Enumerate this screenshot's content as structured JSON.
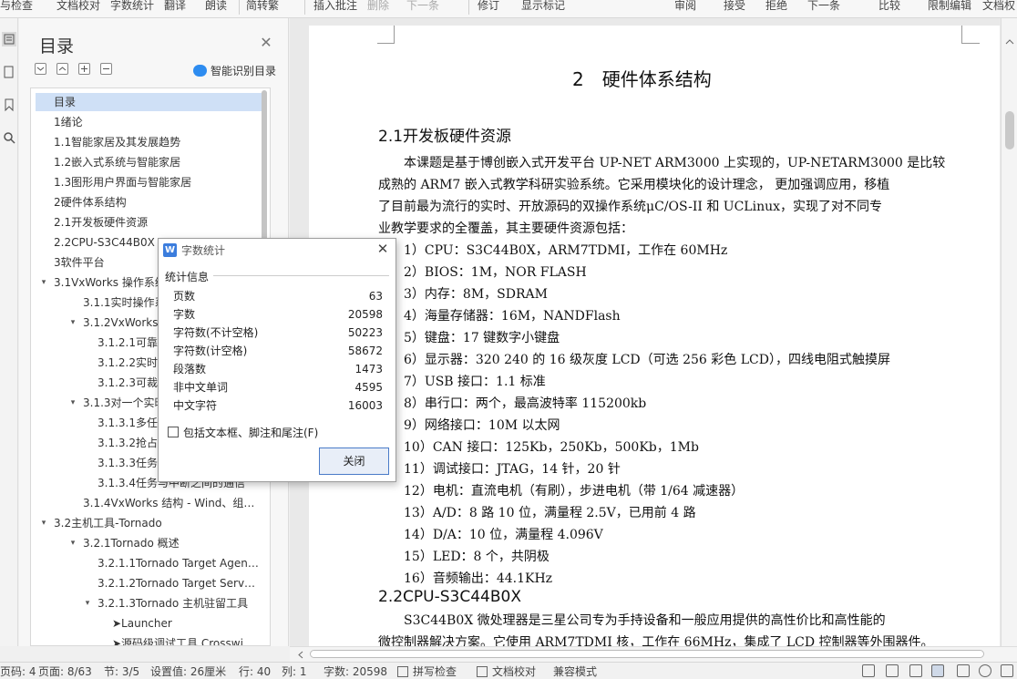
{
  "ribbon": {
    "items": [
      {
        "label": "与检查",
        "disabled": false
      },
      {
        "label": "文档校对",
        "disabled": false
      },
      {
        "label": "字数统计",
        "disabled": false
      },
      {
        "label": "翻译",
        "disabled": false
      },
      {
        "label": "朗读",
        "disabled": false
      },
      {
        "label": "简转繁",
        "disabled": false
      },
      {
        "label": "插入批注",
        "disabled": false
      },
      {
        "label": "删除",
        "disabled": true
      },
      {
        "label": "下一条",
        "disabled": true
      },
      {
        "label": "修订",
        "disabled": false
      },
      {
        "label": "显示标记",
        "disabled": false
      },
      {
        "label": "审阅",
        "disabled": false
      },
      {
        "label": "接受",
        "disabled": false
      },
      {
        "label": "拒绝",
        "disabled": false
      },
      {
        "label": "下一条",
        "disabled": false
      },
      {
        "label": "比较",
        "disabled": false
      },
      {
        "label": "限制编辑",
        "disabled": false
      },
      {
        "label": "文档权",
        "disabled": false
      }
    ]
  },
  "toc": {
    "title": "目录",
    "smart_label": "智能识别目录",
    "items": [
      {
        "label": "目录",
        "selected": true
      },
      {
        "label": "1绪论"
      },
      {
        "label": "1.1智能家居及其发展趋势"
      },
      {
        "label": "1.2嵌入式系统与智能家居"
      },
      {
        "label": "1.3图形用户界面与智能家居"
      },
      {
        "label": "2硬件体系结构"
      },
      {
        "label": "2.1开发板硬件资源"
      },
      {
        "label": "2.2CPU-S3C44B0X"
      },
      {
        "label": "3软件平台"
      },
      {
        "label": "3.1VxWorks 操作系统",
        "toggle": "▾"
      },
      {
        "label": "3.1.1实时操作系统"
      },
      {
        "label": "3.1.2VxWorks",
        "toggle": "▾"
      },
      {
        "label": "3.1.2.1可靠性"
      },
      {
        "label": "3.1.2.2实时性"
      },
      {
        "label": "3.1.2.3可裁减"
      },
      {
        "label": "3.1.3对一个实时",
        "toggle": "▾"
      },
      {
        "label": "3.1.3.1多任务"
      },
      {
        "label": "3.1.3.2抢占调度"
      },
      {
        "label": "3.1.3.3任务间"
      },
      {
        "label": "3.1.3.4任务与中断之间的通信"
      },
      {
        "label": "3.1.4VxWorks 结构 - Wind、组…"
      },
      {
        "label": "3.2主机工具-Tornado",
        "toggle": "▾"
      },
      {
        "label": "3.2.1Tornado 概述",
        "toggle": "▾"
      },
      {
        "label": "3.2.1.1Tornado Target Agen…"
      },
      {
        "label": "3.2.1.2Tornado Target Serve…"
      },
      {
        "label": "3.2.1.3Tornado 主机驻留工具",
        "toggle": "▾"
      },
      {
        "label": "➤Launcher"
      },
      {
        "label": "➤源码级调试工具 Crosswi…"
      }
    ]
  },
  "document": {
    "chapter_title": "2　硬件体系结构",
    "sec1_title": "2.1开发板硬件资源",
    "para1": [
      "本课题是基于博创嵌入式开发平台 UP-NET ARM3000 上实现的，UP-NETARM3000 是比较",
      "成熟的 ARM7 嵌入式教学科研实验系统。它采用模块化的设计理念，  更加强调应用，移植",
      "了目前最为流行的实时、开放源码的双操作系统μC/OS-II 和 UCLinux，实现了对不同专",
      "业教学要求的全覆盖，其主要硬件资源包括："
    ],
    "list": [
      "1）CPU：S3C44B0X，ARM7TDMI，工作在 60MHz",
      "2）BIOS：1M，NOR FLASH",
      "3）内存：8M，SDRAM",
      "4）海量存储器：16M，NANDFlash",
      "5）键盘：17 键数字小键盘",
      "6）显示器：320 240 的 16 级灰度 LCD（可选 256 彩色 LCD），四线电阻式触摸屏",
      "7）USB 接口：1.1 标准",
      "8）串行口：两个，最高波特率 115200kb",
      "9）网络接口：10M 以太网",
      "10）CAN 接口：125Kb，250Kb，500Kb，1Mb",
      "11）调试接口：JTAG，14 针，20 针",
      "12）电机：直流电机（有刷），步进电机（带 1/64 减速器）",
      "13）A/D：8 路 10 位，满量程 2.5V，已用前 4 路",
      "14）D/A：10 位，满量程 4.096V",
      "15）LED：8 个，共阴极",
      "16）音频输出：44.1KHz"
    ],
    "sec2_title": "2.2CPU-S3C44B0X",
    "para2": [
      "S3C44B0X 微处理器是三星公司专为手持设备和一般应用提供的高性价比和高性能的",
      "微控制器解决方案。它使用 ARM7TDMI 核，工作在 66MHz，集成了 LCD 控制器等外围器件。"
    ]
  },
  "dialog": {
    "title": "字数统计",
    "section": "统计信息",
    "rows": [
      {
        "label": "页数",
        "value": "63"
      },
      {
        "label": "字数",
        "value": "20598"
      },
      {
        "label": "字符数(不计空格)",
        "value": "50223"
      },
      {
        "label": "字符数(计空格)",
        "value": "58672"
      },
      {
        "label": "段落数",
        "value": "1473"
      },
      {
        "label": "非中文单词",
        "value": "4595"
      },
      {
        "label": "中文字符",
        "value": "16003"
      }
    ],
    "checkbox_label": "包括文本框、脚注和尾注(F)",
    "close_label": "关闭"
  },
  "status": {
    "page_num": "页码: 4",
    "page": "页面: 8/63",
    "section": "节: 3/5",
    "position": "设置值: 26厘米",
    "row": "行: 40",
    "col": "列: 1",
    "words": "字数: 20598",
    "spell": "拼写检查",
    "proof": "文档校对",
    "compat": "兼容模式"
  }
}
